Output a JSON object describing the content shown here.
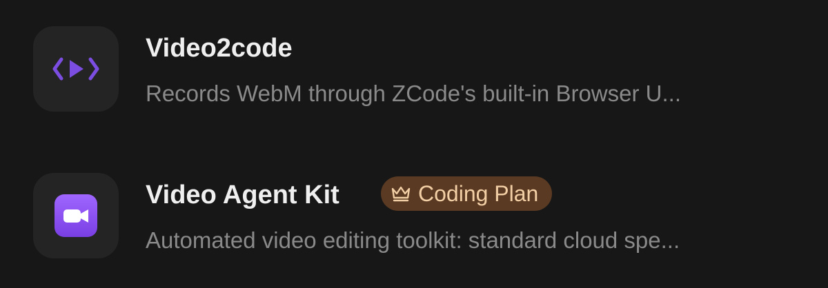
{
  "items": [
    {
      "title": "Video2code",
      "description": "Records WebM through ZCode's built-in Browser U...",
      "icon": "code-play-icon"
    },
    {
      "title": "Video Agent Kit",
      "description": "Automated video editing toolkit: standard cloud spe...",
      "icon": "video-camera-icon",
      "badge": {
        "label": "Coding Plan",
        "icon": "crown-icon"
      }
    }
  ],
  "colors": {
    "background": "#171717",
    "icon_tile": "#242424",
    "accent_purple": "#7b4de0",
    "badge_bg": "#5a3a22",
    "badge_text": "#f3cfa6"
  }
}
